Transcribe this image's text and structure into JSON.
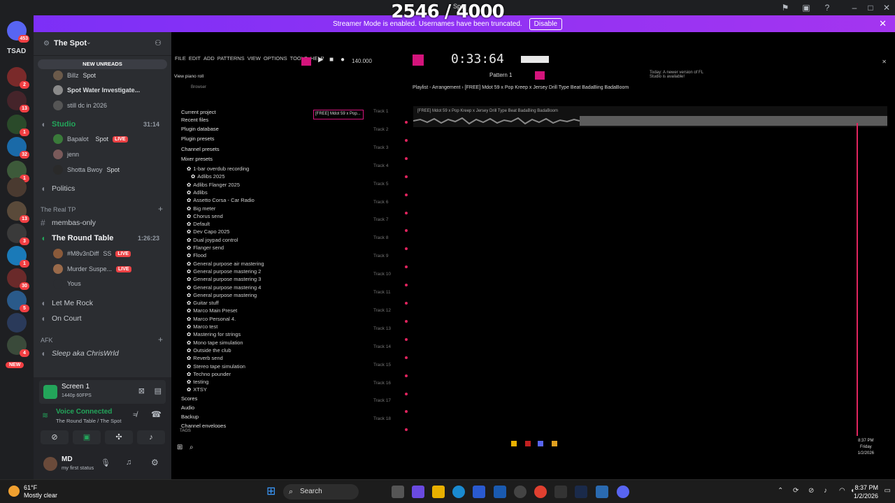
{
  "overlay": {
    "counter": "2546 / 4000",
    "sub": "Spot"
  },
  "banner": {
    "text": "Streamer Mode is enabled. Usernames have been truncated.",
    "button": "Disable"
  },
  "rail": {
    "home_badge": "453",
    "label_tsad": "TSAD",
    "badges": [
      "2",
      "13",
      "1",
      "32",
      "1",
      "13",
      "3",
      "1",
      "30",
      "5",
      "4"
    ],
    "new_label": "NEW"
  },
  "server": {
    "name": "The Spot",
    "new_unreads": "NEW UNREADS",
    "users_top": [
      {
        "name": "Billz",
        "tag": "Spot"
      },
      {
        "name": "Spot Water Investigate..."
      },
      {
        "name": "still dc in 2026"
      }
    ],
    "studio": {
      "name": "Studio",
      "time": "31:14"
    },
    "studio_users": [
      {
        "name": "Bapalot",
        "tag": "Spot",
        "live": "LIVE"
      },
      {
        "name": "jenn"
      },
      {
        "name": "Shotta Bwoy",
        "tag": "Spot"
      }
    ],
    "politics": "Politics",
    "cat_real_tp": "The Real TP",
    "membas_only": "membas-only",
    "round_table": {
      "name": "The Round Table",
      "time": "1:26:23"
    },
    "round_users": [
      {
        "name": "#M8v3nDiff",
        "tag": "SS",
        "live": "LIVE"
      },
      {
        "name": "Murder Suspe...",
        "live": "LIVE"
      },
      {
        "name": "Yous"
      }
    ],
    "let_me_rock": "Let Me Rock",
    "on_court": "On Court",
    "cat_afk": "AFK",
    "afk_channel": "Sleep aka ChrisWrld"
  },
  "panel": {
    "screen_title": "Screen 1",
    "screen_sub": "1440p 60FPS",
    "voice_status": "Voice Connected",
    "voice_channel": "The Round Table / The Spot",
    "user_name": "MD",
    "user_status": "my first status"
  },
  "fl": {
    "menu": [
      "FILE",
      "EDIT",
      "ADD",
      "PATTERNS",
      "VIEW",
      "OPTIONS",
      "TOOLS",
      "HELP"
    ],
    "tempo": "140.000",
    "time": "0:33:64",
    "pattern": "Pattern 1",
    "hint": "View piano roll",
    "news": "Today: A newer version of FL Studio is available!",
    "browser_label": "Browser",
    "playlist_title": "Playlist - Arrangement › [FREE] Mdot 59 x Pop Kreep x Jersey Drill Type Beat BadaBing BadaBoom",
    "clip_name": "[FREE] Mdot 59 x Pop Kreep x Jersey Drill Type Beat BadaBing BadaBoom",
    "pattern_clip": "[FREE] Mdot 59 x Pop...",
    "folders": [
      "Current project",
      "Recent files",
      "Plugin database",
      "Plugin presets",
      "Channel presets",
      "Mixer presets"
    ],
    "presets": [
      "1-bar overdub recording",
      "Adlibs 2025",
      "Adlibs Flanger 2025",
      "Adlibs",
      "Assetto Corsa - Car Radio",
      "Big meter",
      "Chorus send",
      "Default",
      "Dev Capo 2025",
      "Dual joypad control",
      "Flanger send",
      "Flood",
      "General purpose air mastering",
      "General purpose mastering 2",
      "General purpose mastering 3",
      "General purpose mastering 4",
      "General purpose mastering",
      "Guitar stuff",
      "Marco Main Preset",
      "Marco Personal 4.",
      "Marco test",
      "Mastering for strings",
      "Mono tape simulation",
      "Outside the club",
      "Reverb send",
      "Stereo tape simulation",
      "Techno pounder",
      "testing",
      "XTSY"
    ],
    "folders2": [
      "Scores",
      "Audio",
      "Backup",
      "Channel envelopes"
    ],
    "tags": "TAGS",
    "tracks": [
      "Track 1",
      "Track 2",
      "Track 3",
      "Track 4",
      "Track 5",
      "Track 6",
      "Track 7",
      "Track 8",
      "Track 9",
      "Track 10",
      "Track 11",
      "Track 12",
      "Track 13",
      "Track 14",
      "Track 15",
      "Track 16",
      "Track 17",
      "Track 18"
    ],
    "inner_clock": {
      "time": "8:37 PM",
      "day": "Friday",
      "date": "1/2/2026"
    }
  },
  "taskbar": {
    "weather_temp": "61°F",
    "weather_desc": "Mostly clear",
    "search": "Search",
    "time": "8:37 PM",
    "date": "1/2/2026"
  },
  "colors": {
    "accent": "#9b30ff",
    "voice": "#23a55a",
    "live": "#ed4245",
    "fl_pink": "#d4147c"
  }
}
